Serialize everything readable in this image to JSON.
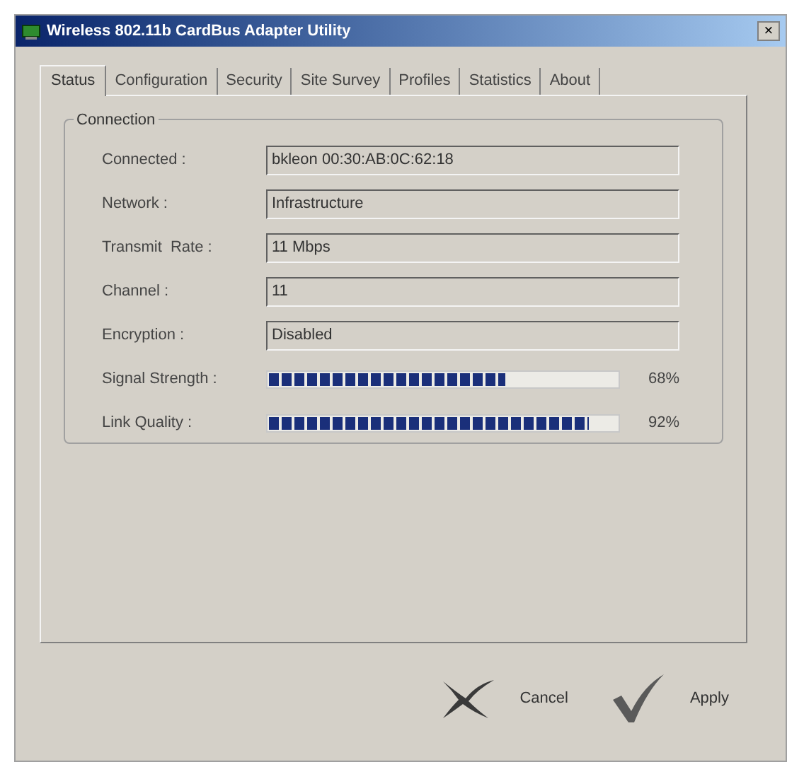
{
  "window": {
    "title": "Wireless 802.11b CardBus Adapter Utility",
    "close": "×"
  },
  "tabs": [
    {
      "label": "Status",
      "selected": true
    },
    {
      "label": "Configuration",
      "selected": false
    },
    {
      "label": "Security",
      "selected": false
    },
    {
      "label": "Site Survey",
      "selected": false
    },
    {
      "label": "Profiles",
      "selected": false
    },
    {
      "label": "Statistics",
      "selected": false
    },
    {
      "label": "About",
      "selected": false
    }
  ],
  "group": {
    "title": "Connection",
    "rows": [
      {
        "kind": "field",
        "label": "Connected :",
        "value": "bkleon 00:30:AB:0C:62:18"
      },
      {
        "kind": "field",
        "label": "Network :",
        "value": "Infrastructure"
      },
      {
        "kind": "field",
        "label": "Transmit  Rate :",
        "value": "11 Mbps"
      },
      {
        "kind": "field",
        "label": "Channel :",
        "value": "11"
      },
      {
        "kind": "field",
        "label": "Encryption :",
        "value": "Disabled"
      },
      {
        "kind": "meter",
        "label": "Signal Strength :",
        "level": 0.68,
        "reading": "68%"
      },
      {
        "kind": "meter",
        "label": "Link Quality :",
        "level": 0.92,
        "reading": "92%"
      }
    ]
  },
  "buttons": [
    {
      "kind": "cancel",
      "label": "Cancel"
    },
    {
      "kind": "apply",
      "label": "Apply"
    }
  ]
}
